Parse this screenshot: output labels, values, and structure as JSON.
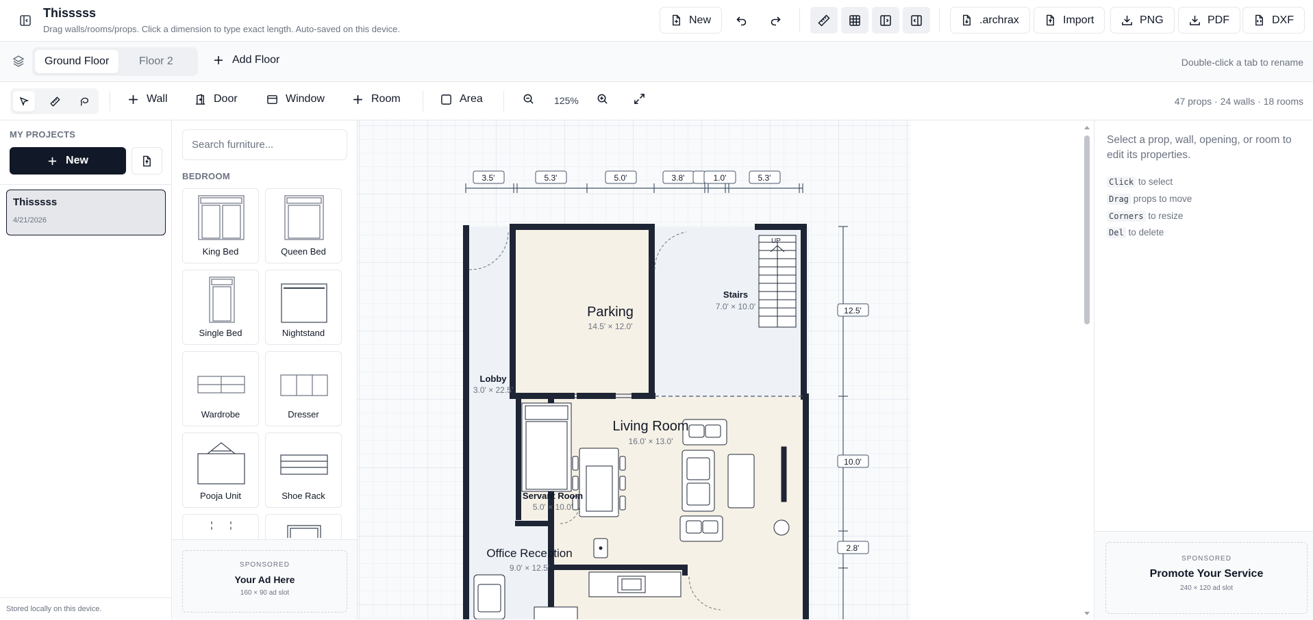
{
  "header": {
    "title": "Thisssss",
    "subtitle": "Drag walls/rooms/props. Click a dimension to type exact length. Auto-saved on this device.",
    "new_label": "New",
    "archrax_label": ".archrax",
    "import_label": "Import",
    "png_label": "PNG",
    "pdf_label": "PDF",
    "dxf_label": "DXF"
  },
  "floors": {
    "tabs": [
      "Ground Floor",
      "Floor 2"
    ],
    "active": "Ground Floor",
    "add_label": "Add Floor",
    "hint": "Double-click a tab to rename"
  },
  "tools": {
    "wall": "Wall",
    "door": "Door",
    "window": "Window",
    "room": "Room",
    "area": "Area",
    "zoom": "125%",
    "counts": "47 props · 24 walls · 18 rooms"
  },
  "projects": {
    "heading": "MY PROJECTS",
    "new_label": "New",
    "items": [
      {
        "name": "Thisssss",
        "date": "4/21/2026"
      }
    ],
    "footer": "Stored locally on this device."
  },
  "furniture": {
    "search_placeholder": "Search furniture...",
    "category": "BEDROOM",
    "items": [
      "King Bed",
      "Queen Bed",
      "Single Bed",
      "Nightstand",
      "Wardrobe",
      "Dresser",
      "Pooja Unit",
      "Shoe Rack"
    ],
    "ad": {
      "label": "SPONSORED",
      "title": "Your Ad Here",
      "size": "160 × 90 ad slot"
    }
  },
  "plan": {
    "dims_top": [
      "3.5'",
      "5.3'",
      "5.0'",
      "3.8'",
      "1.0'",
      "5.3'"
    ],
    "dims_right": [
      "12.5'",
      "10.0'",
      "2.8'"
    ],
    "rooms": [
      {
        "name": "Parking",
        "size": "14.5' × 12.0'"
      },
      {
        "name": "Stairs",
        "size": "7.0' × 10.0'"
      },
      {
        "name": "Lobby",
        "size": "3.0' × 22.5'"
      },
      {
        "name": "Living Room",
        "size": "16.0' × 13.0'"
      },
      {
        "name": "Servant Room",
        "size": "5.0' × 10.0'"
      },
      {
        "name": "Office Reception",
        "size": "9.0' × 12.5'"
      }
    ],
    "stairs_label": "UP"
  },
  "properties": {
    "intro": "Select a prop, wall, opening, or room to edit its properties.",
    "hints": [
      {
        "key": "Click",
        "text": "to select"
      },
      {
        "key": "Drag",
        "text": "props to move"
      },
      {
        "key": "Corners",
        "text": "to resize"
      },
      {
        "key": "Del",
        "text": "to delete"
      }
    ],
    "ad": {
      "label": "SPONSORED",
      "title": "Promote Your Service",
      "size": "240 × 120 ad slot"
    }
  },
  "colors": {
    "wall": "#1e2535",
    "room_fill": "#f6f1e6",
    "lobby_fill": "#eef2f6",
    "primary": "#111827"
  }
}
